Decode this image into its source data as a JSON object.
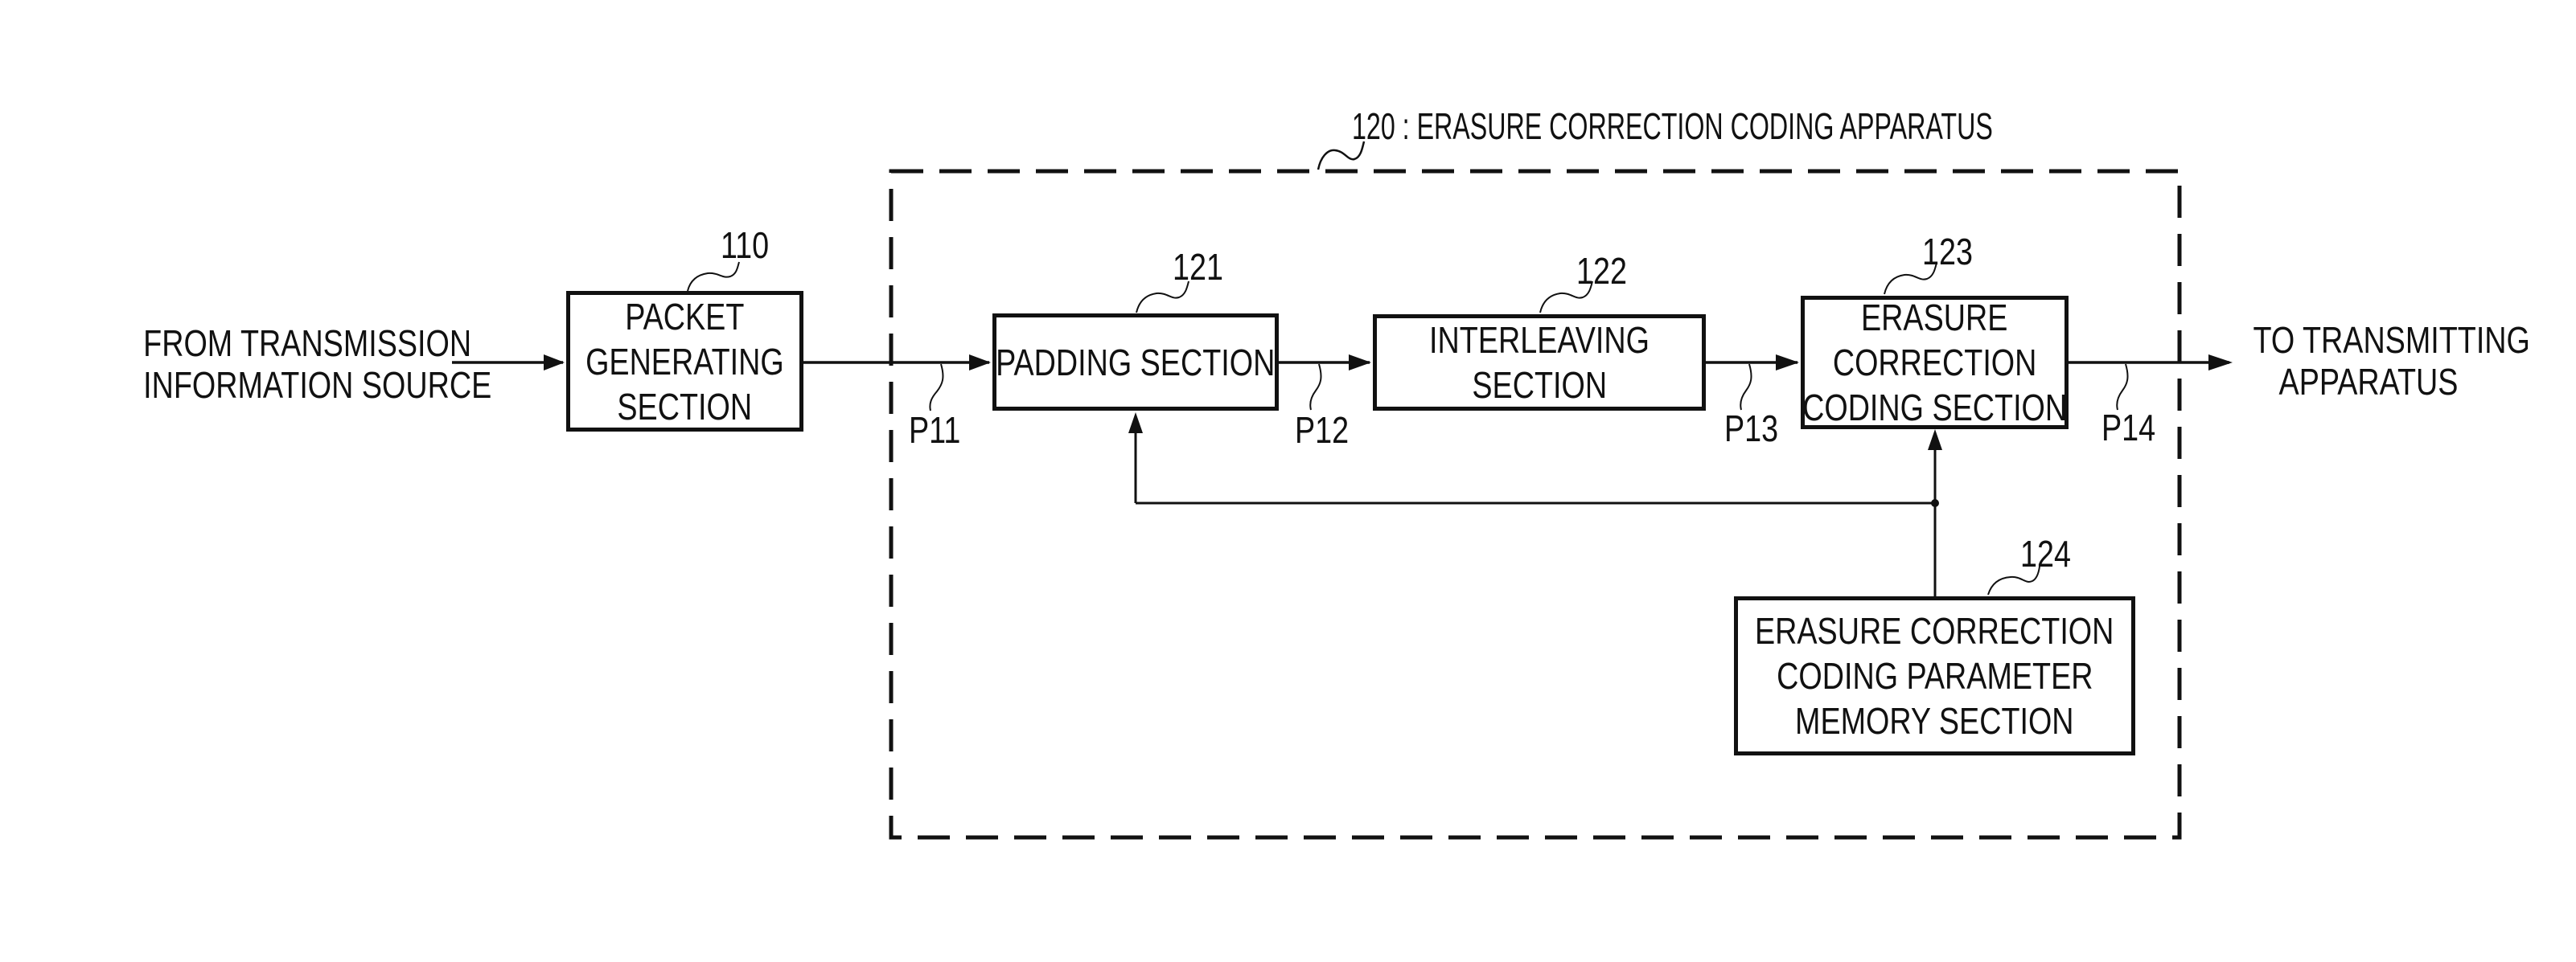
{
  "figure": {
    "apparatus": {
      "ref": "120",
      "title": "120 : ERASURE CORRECTION CODING APPARATUS"
    },
    "input": {
      "lines": [
        "FROM TRANSMISSION",
        "INFORMATION SOURCE"
      ]
    },
    "output": {
      "lines": [
        "TO TRANSMITTING",
        "APPARATUS"
      ]
    },
    "blocks": [
      {
        "id": "110",
        "ref": "110",
        "lines": [
          "PACKET",
          "GENERATING",
          "SECTION"
        ]
      },
      {
        "id": "121",
        "ref": "121",
        "lines": [
          "PADDING SECTION"
        ]
      },
      {
        "id": "122",
        "ref": "122",
        "lines": [
          "INTERLEAVING",
          "SECTION"
        ]
      },
      {
        "id": "123",
        "ref": "123",
        "lines": [
          "ERASURE",
          "CORRECTION",
          "CODING SECTION"
        ]
      },
      {
        "id": "124",
        "ref": "124",
        "lines": [
          "ERASURE CORRECTION",
          "CODING PARAMETER",
          "MEMORY SECTION"
        ]
      }
    ],
    "signals": [
      {
        "id": "P11",
        "label": "P11",
        "from": "110",
        "to": "121"
      },
      {
        "id": "P12",
        "label": "P12",
        "from": "121",
        "to": "122"
      },
      {
        "id": "P13",
        "label": "P13",
        "from": "122",
        "to": "123"
      },
      {
        "id": "P14",
        "label": "P14",
        "from": "123",
        "to": "output"
      }
    ],
    "feedback": {
      "from": "124",
      "to": [
        "123",
        "121"
      ]
    }
  }
}
